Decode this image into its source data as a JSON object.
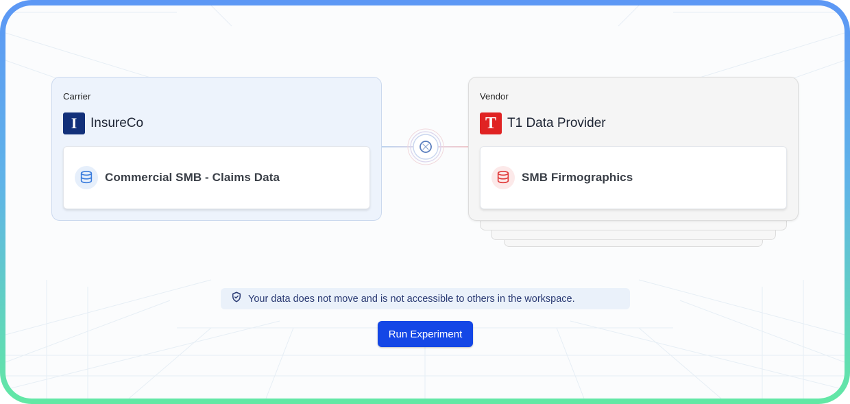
{
  "carrier": {
    "role": "Carrier",
    "org_name": "InsureCo",
    "logo_letter": "I",
    "logo_color": "#12307a",
    "dataset": {
      "label": "Commercial SMB - Claims Data",
      "icon": "database-icon",
      "icon_color": "#3b7ddd"
    }
  },
  "vendor": {
    "role": "Vendor",
    "org_name": "T1 Data Provider",
    "logo_letter": "T",
    "logo_color": "#e02323",
    "dataset": {
      "label": "SMB Firmographics",
      "icon": "database-icon",
      "icon_color": "#e03a3a"
    }
  },
  "connection": {
    "icon": "link-swirl-icon"
  },
  "notice": {
    "icon": "shield-check-icon",
    "text": "Your data does not move and is not accessible to others in the workspace."
  },
  "actions": {
    "run_label": "Run Experiment",
    "accent": "#1447e6"
  }
}
